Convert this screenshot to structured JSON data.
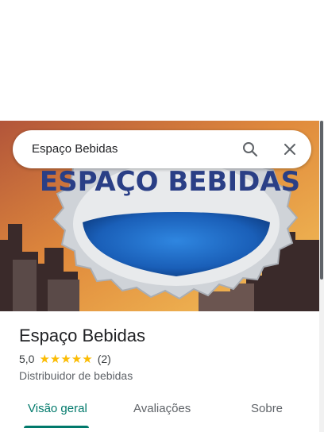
{
  "search": {
    "query": "Espaço Bebidas"
  },
  "hero": {
    "sign_text": "ESPAÇO BEBIDAS"
  },
  "place": {
    "name": "Espaço Bebidas",
    "rating": "5,0",
    "stars": "★★★★★",
    "review_count": "(2)",
    "category": "Distribuidor de bebidas"
  },
  "tabs": [
    {
      "label": "Visão geral",
      "active": true
    },
    {
      "label": "Avaliações",
      "active": false
    },
    {
      "label": "Sobre",
      "active": false
    }
  ],
  "colors": {
    "accent": "#00796b",
    "star": "#fbbc04"
  }
}
